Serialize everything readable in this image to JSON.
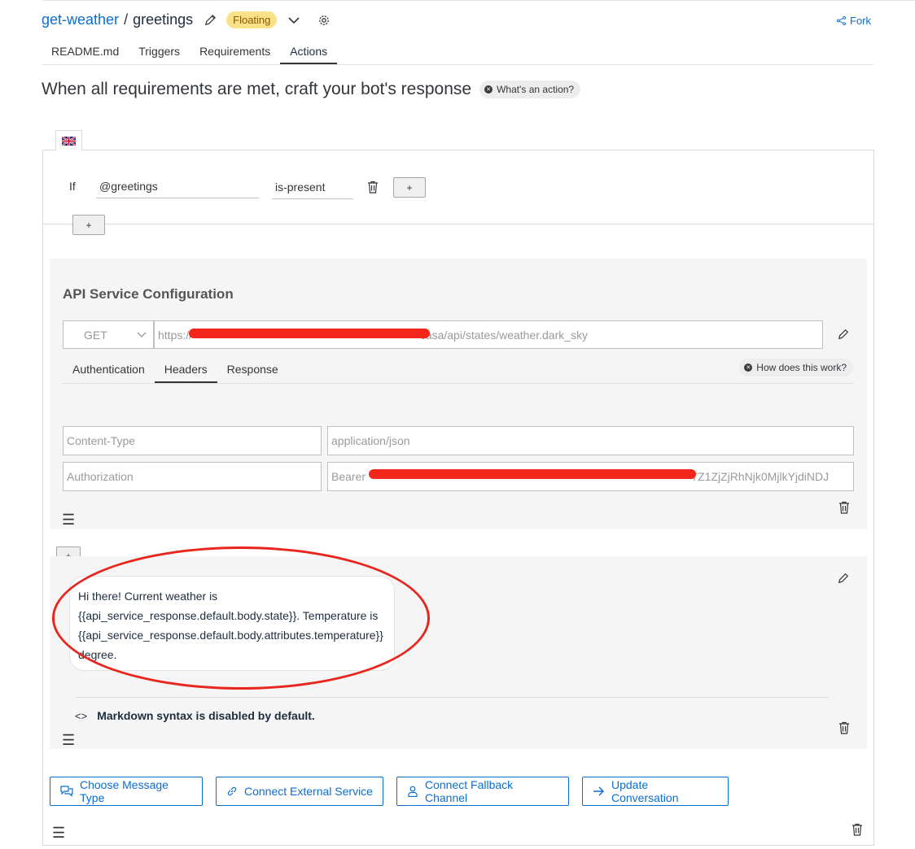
{
  "breadcrumb": {
    "project": "get-weather",
    "separator": "/",
    "skill": "greetings",
    "badge": "Floating"
  },
  "fork_label": "Fork",
  "tabs": [
    {
      "label": "README.md"
    },
    {
      "label": "Triggers"
    },
    {
      "label": "Requirements"
    },
    {
      "label": "Actions",
      "active": true
    }
  ],
  "heading": "When all requirements are met, craft your bot's response",
  "whats_action": "What's an action?",
  "condition": {
    "if_label": "If",
    "variable": "@greetings",
    "operator": "is-present",
    "add_label": "+",
    "add_group_label": "+"
  },
  "api": {
    "title": "API Service Configuration",
    "method": "GET",
    "url_start": "https://",
    "url_end": "casa/api/states/weather.dark_sky",
    "subtabs": [
      {
        "label": "Authentication"
      },
      {
        "label": "Headers",
        "active": true
      },
      {
        "label": "Response"
      }
    ],
    "how_label": "How does this work?",
    "headers": [
      {
        "key": "Content-Type",
        "value": "application/json"
      },
      {
        "key": "Authorization",
        "value_start": "Bearer",
        "value_end": "TZ1ZjZjRhNjk0MjlkYjdiNDJ"
      }
    ]
  },
  "add_message_label": "+",
  "message": {
    "line1": "Hi there! Current weather is",
    "line2": "{{api_service_response.default.body.state}}. Temperature is",
    "line3": "{{api_service_response.default.body.attributes.temperature}}",
    "line4": "degree."
  },
  "markdown_note": "Markdown syntax is disabled by default.",
  "markdown_code": "<>",
  "action_buttons": {
    "choose": "Choose Message Type",
    "connect": "Connect External Service",
    "fallback": "Connect Fallback Channel",
    "update": "Update Conversation"
  },
  "colors": {
    "accent": "#0a6ed1",
    "badge": "#fbe08a",
    "highlight": "#e8261e"
  }
}
